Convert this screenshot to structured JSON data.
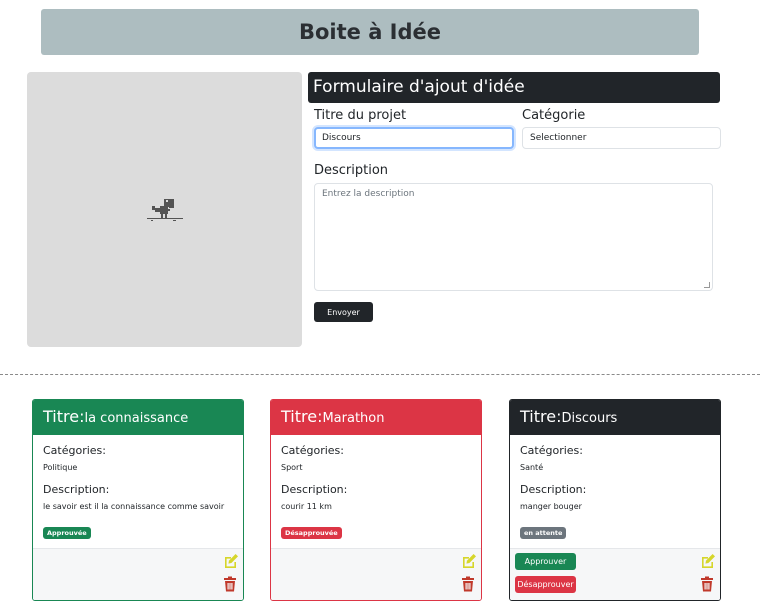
{
  "banner": {
    "title": "Boite à Idée"
  },
  "form": {
    "header": "Formulaire d'ajout d'idée",
    "title_label": "Titre du projet",
    "title_value": "Discours",
    "category_label": "Catégorie",
    "category_value": "Selectionner",
    "description_label": "Description",
    "description_placeholder": "Entrez la description",
    "submit_label": "Envoyer"
  },
  "cards": [
    {
      "title_prefix": "Titre:",
      "title": "la connaissance",
      "categories_label": "Catégories:",
      "category": "Politique",
      "description_label": "Description:",
      "description": "le savoir est il la connaissance comme savoir",
      "status": "Approuvée",
      "color": "#198754"
    },
    {
      "title_prefix": "Titre:",
      "title": "Marathon",
      "categories_label": "Catégories:",
      "category": "Sport",
      "description_label": "Description:",
      "description": "courir 11 km",
      "status": "Désapprouvée",
      "color": "#dc3545"
    },
    {
      "title_prefix": "Titre:",
      "title": "Discours",
      "categories_label": "Catégories:",
      "category": "Santé",
      "description_label": "Description:",
      "description": "manger bouger",
      "status": "en attente",
      "color": "#212529",
      "approve_label": "Approuver",
      "disapprove_label": "Désapprouver"
    }
  ],
  "colors": {
    "banner": "#adbdc0",
    "approve": "#198754",
    "danger": "#dc3545",
    "pending": "#6c757d",
    "edit_icon": "#d6d62a",
    "delete_icon": "#c0392b"
  },
  "icons": [
    "dinosaur-icon",
    "edit-icon",
    "trash-icon"
  ]
}
